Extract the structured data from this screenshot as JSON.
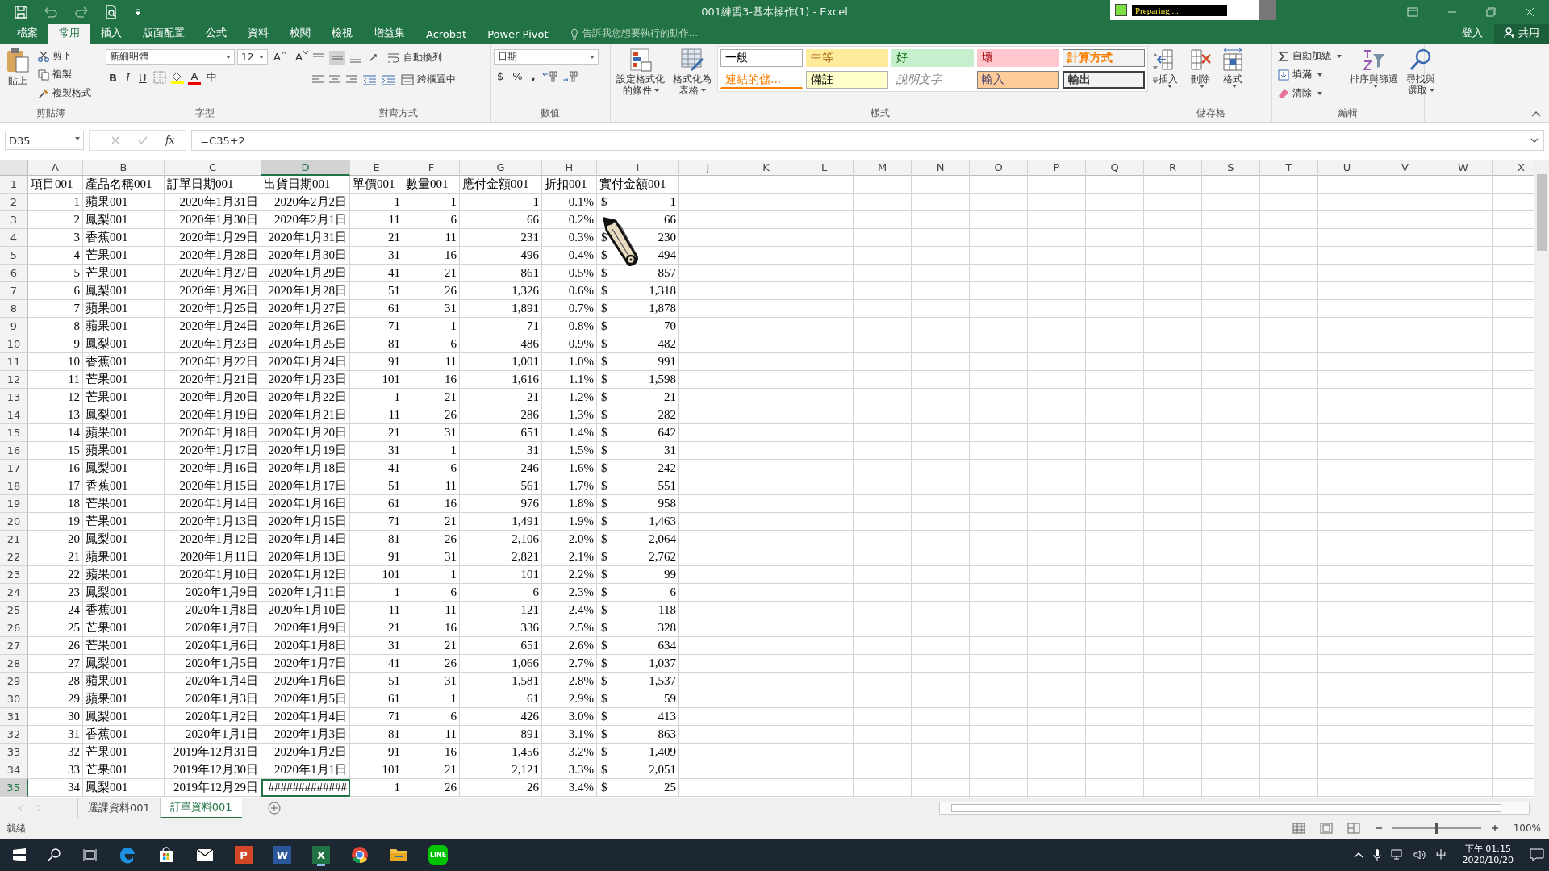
{
  "window": {
    "title": "001練習3-基本操作(1) - Excel",
    "progress": "Preparing ..."
  },
  "tabs": [
    {
      "label": "檔案",
      "selected": false
    },
    {
      "label": "常用",
      "selected": true
    },
    {
      "label": "插入",
      "selected": false
    },
    {
      "label": "版面配置",
      "selected": false
    },
    {
      "label": "公式",
      "selected": false
    },
    {
      "label": "資料",
      "selected": false
    },
    {
      "label": "校閱",
      "selected": false
    },
    {
      "label": "檢視",
      "selected": false
    },
    {
      "label": "增益集",
      "selected": false
    },
    {
      "label": "Acrobat",
      "selected": false
    },
    {
      "label": "Power Pivot",
      "selected": false
    }
  ],
  "tell_me": "告訴我您想要執行的動作...",
  "sign_in": "登入",
  "share": "共用",
  "ribbon": {
    "clipboard": {
      "label": "剪貼簿",
      "paste": "貼上",
      "cut": "剪下",
      "copy": "複製",
      "format_painter": "複製格式"
    },
    "font": {
      "label": "字型",
      "font_name": "新細明體",
      "font_size": "12",
      "grow": "A",
      "shrink": "A",
      "bold": "B",
      "italic": "I",
      "underline": "U",
      "font_color": "A",
      "phonetic": "中"
    },
    "alignment": {
      "label": "對齊方式",
      "wrap_text": "自動換列",
      "merge_center": "跨欄置中"
    },
    "number": {
      "label": "數值",
      "format": "日期",
      "currency": "$",
      "percent": "%",
      "comma": ","
    },
    "styles": {
      "label": "樣式",
      "conditional": [
        "設定格式化",
        "的條件"
      ],
      "as_table": [
        "格式化為",
        "表格"
      ],
      "gallery": [
        {
          "label": "一般",
          "kind": "normal"
        },
        {
          "label": "中等",
          "kind": "neutral"
        },
        {
          "label": "好",
          "kind": "good"
        },
        {
          "label": "壞",
          "kind": "bad"
        },
        {
          "label": "計算方式",
          "kind": "calculation"
        },
        {
          "label": "連結的儲...",
          "kind": "linked"
        },
        {
          "label": "備註",
          "kind": "note"
        },
        {
          "label": "說明文字",
          "kind": "explanatory"
        },
        {
          "label": "輸入",
          "kind": "input"
        },
        {
          "label": "輸出",
          "kind": "output"
        }
      ]
    },
    "cells": {
      "label": "儲存格",
      "insert": "插入",
      "delete": "刪除",
      "format": "格式"
    },
    "editing": {
      "label": "編輯",
      "autosum": "自動加總",
      "fill": "填滿",
      "clear": "清除",
      "sort": [
        "排序與篩選"
      ],
      "find": [
        "尋找與",
        "選取"
      ]
    }
  },
  "formula_bar": {
    "name_box": "D35",
    "fx": "fx",
    "formula": "=C35+2"
  },
  "columns": [
    {
      "label": "A",
      "selected": false
    },
    {
      "label": "B",
      "selected": false
    },
    {
      "label": "C",
      "selected": false
    },
    {
      "label": "D",
      "selected": true
    },
    {
      "label": "E",
      "selected": false
    },
    {
      "label": "F",
      "selected": false
    },
    {
      "label": "G",
      "selected": false
    },
    {
      "label": "H",
      "selected": false
    },
    {
      "label": "I",
      "selected": false
    },
    {
      "label": "J",
      "selected": false
    },
    {
      "label": "K",
      "selected": false
    },
    {
      "label": "L",
      "selected": false
    },
    {
      "label": "M",
      "selected": false
    },
    {
      "label": "N",
      "selected": false
    },
    {
      "label": "O",
      "selected": false
    },
    {
      "label": "P",
      "selected": false
    },
    {
      "label": "Q",
      "selected": false
    },
    {
      "label": "R",
      "selected": false
    },
    {
      "label": "S",
      "selected": false
    },
    {
      "label": "T",
      "selected": false
    },
    {
      "label": "U",
      "selected": false
    },
    {
      "label": "V",
      "selected": false
    },
    {
      "label": "W",
      "selected": false
    },
    {
      "label": "X",
      "selected": false
    }
  ],
  "rows": [
    {
      "n": "1",
      "kind": "header",
      "selected": false,
      "cells": [
        "項目001",
        "產品名稱001",
        "訂單日期001",
        "出貨日期001",
        "單價001",
        "數量001",
        "應付金額001",
        "折扣001",
        "實付金額001"
      ]
    },
    {
      "n": "2",
      "kind": "data",
      "selected": false,
      "currency": "$",
      "cells": [
        "1",
        "蘋果001",
        "2020年1月31日",
        "2020年2月2日",
        "1",
        "1",
        "1",
        "0.1%",
        "1"
      ]
    },
    {
      "n": "3",
      "kind": "data",
      "selected": false,
      "cells": [
        "2",
        "鳳梨001",
        "2020年1月30日",
        "2020年2月1日",
        "11",
        "6",
        "66",
        "0.2%",
        "66"
      ]
    },
    {
      "n": "4",
      "kind": "data",
      "selected": false,
      "currency": "$",
      "cells": [
        "3",
        "香蕉001",
        "2020年1月29日",
        "2020年1月31日",
        "21",
        "11",
        "231",
        "0.3%",
        "230"
      ]
    },
    {
      "n": "5",
      "kind": "data",
      "selected": false,
      "currency": "$",
      "cells": [
        "4",
        "芒果001",
        "2020年1月28日",
        "2020年1月30日",
        "31",
        "16",
        "496",
        "0.4%",
        "494"
      ]
    },
    {
      "n": "6",
      "kind": "data",
      "selected": false,
      "currency": "$",
      "cells": [
        "5",
        "芒果001",
        "2020年1月27日",
        "2020年1月29日",
        "41",
        "21",
        "861",
        "0.5%",
        "857"
      ]
    },
    {
      "n": "7",
      "kind": "data",
      "selected": false,
      "currency": "$",
      "cells": [
        "6",
        "鳳梨001",
        "2020年1月26日",
        "2020年1月28日",
        "51",
        "26",
        "1,326",
        "0.6%",
        "1,318"
      ]
    },
    {
      "n": "8",
      "kind": "data",
      "selected": false,
      "currency": "$",
      "cells": [
        "7",
        "蘋果001",
        "2020年1月25日",
        "2020年1月27日",
        "61",
        "31",
        "1,891",
        "0.7%",
        "1,878"
      ]
    },
    {
      "n": "9",
      "kind": "data",
      "selected": false,
      "currency": "$",
      "cells": [
        "8",
        "蘋果001",
        "2020年1月24日",
        "2020年1月26日",
        "71",
        "1",
        "71",
        "0.8%",
        "70"
      ]
    },
    {
      "n": "10",
      "kind": "data",
      "selected": false,
      "currency": "$",
      "cells": [
        "9",
        "鳳梨001",
        "2020年1月23日",
        "2020年1月25日",
        "81",
        "6",
        "486",
        "0.9%",
        "482"
      ]
    },
    {
      "n": "11",
      "kind": "data",
      "selected": false,
      "currency": "$",
      "cells": [
        "10",
        "香蕉001",
        "2020年1月22日",
        "2020年1月24日",
        "91",
        "11",
        "1,001",
        "1.0%",
        "991"
      ]
    },
    {
      "n": "12",
      "kind": "data",
      "selected": false,
      "currency": "$",
      "cells": [
        "11",
        "芒果001",
        "2020年1月21日",
        "2020年1月23日",
        "101",
        "16",
        "1,616",
        "1.1%",
        "1,598"
      ]
    },
    {
      "n": "13",
      "kind": "data",
      "selected": false,
      "currency": "$",
      "cells": [
        "12",
        "芒果001",
        "2020年1月20日",
        "2020年1月22日",
        "1",
        "21",
        "21",
        "1.2%",
        "21"
      ]
    },
    {
      "n": "14",
      "kind": "data",
      "selected": false,
      "currency": "$",
      "cells": [
        "13",
        "鳳梨001",
        "2020年1月19日",
        "2020年1月21日",
        "11",
        "26",
        "286",
        "1.3%",
        "282"
      ]
    },
    {
      "n": "15",
      "kind": "data",
      "selected": false,
      "currency": "$",
      "cells": [
        "14",
        "蘋果001",
        "2020年1月18日",
        "2020年1月20日",
        "21",
        "31",
        "651",
        "1.4%",
        "642"
      ]
    },
    {
      "n": "16",
      "kind": "data",
      "selected": false,
      "currency": "$",
      "cells": [
        "15",
        "蘋果001",
        "2020年1月17日",
        "2020年1月19日",
        "31",
        "1",
        "31",
        "1.5%",
        "31"
      ]
    },
    {
      "n": "17",
      "kind": "data",
      "selected": false,
      "currency": "$",
      "cells": [
        "16",
        "鳳梨001",
        "2020年1月16日",
        "2020年1月18日",
        "41",
        "6",
        "246",
        "1.6%",
        "242"
      ]
    },
    {
      "n": "18",
      "kind": "data",
      "selected": false,
      "currency": "$",
      "cells": [
        "17",
        "香蕉001",
        "2020年1月15日",
        "2020年1月17日",
        "51",
        "11",
        "561",
        "1.7%",
        "551"
      ]
    },
    {
      "n": "19",
      "kind": "data",
      "selected": false,
      "currency": "$",
      "cells": [
        "18",
        "芒果001",
        "2020年1月14日",
        "2020年1月16日",
        "61",
        "16",
        "976",
        "1.8%",
        "958"
      ]
    },
    {
      "n": "20",
      "kind": "data",
      "selected": false,
      "currency": "$",
      "cells": [
        "19",
        "芒果001",
        "2020年1月13日",
        "2020年1月15日",
        "71",
        "21",
        "1,491",
        "1.9%",
        "1,463"
      ]
    },
    {
      "n": "21",
      "kind": "data",
      "selected": false,
      "currency": "$",
      "cells": [
        "20",
        "鳳梨001",
        "2020年1月12日",
        "2020年1月14日",
        "81",
        "26",
        "2,106",
        "2.0%",
        "2,064"
      ]
    },
    {
      "n": "22",
      "kind": "data",
      "selected": false,
      "currency": "$",
      "cells": [
        "21",
        "蘋果001",
        "2020年1月11日",
        "2020年1月13日",
        "91",
        "31",
        "2,821",
        "2.1%",
        "2,762"
      ]
    },
    {
      "n": "23",
      "kind": "data",
      "selected": false,
      "currency": "$",
      "cells": [
        "22",
        "蘋果001",
        "2020年1月10日",
        "2020年1月12日",
        "101",
        "1",
        "101",
        "2.2%",
        "99"
      ]
    },
    {
      "n": "24",
      "kind": "data",
      "selected": false,
      "currency": "$",
      "cells": [
        "23",
        "鳳梨001",
        "2020年1月9日",
        "2020年1月11日",
        "1",
        "6",
        "6",
        "2.3%",
        "6"
      ]
    },
    {
      "n": "25",
      "kind": "data",
      "selected": false,
      "currency": "$",
      "cells": [
        "24",
        "香蕉001",
        "2020年1月8日",
        "2020年1月10日",
        "11",
        "11",
        "121",
        "2.4%",
        "118"
      ]
    },
    {
      "n": "26",
      "kind": "data",
      "selected": false,
      "currency": "$",
      "cells": [
        "25",
        "芒果001",
        "2020年1月7日",
        "2020年1月9日",
        "21",
        "16",
        "336",
        "2.5%",
        "328"
      ]
    },
    {
      "n": "27",
      "kind": "data",
      "selected": false,
      "currency": "$",
      "cells": [
        "26",
        "芒果001",
        "2020年1月6日",
        "2020年1月8日",
        "31",
        "21",
        "651",
        "2.6%",
        "634"
      ]
    },
    {
      "n": "28",
      "kind": "data",
      "selected": false,
      "currency": "$",
      "cells": [
        "27",
        "鳳梨001",
        "2020年1月5日",
        "2020年1月7日",
        "41",
        "26",
        "1,066",
        "2.7%",
        "1,037"
      ]
    },
    {
      "n": "29",
      "kind": "data",
      "selected": false,
      "currency": "$",
      "cells": [
        "28",
        "蘋果001",
        "2020年1月4日",
        "2020年1月6日",
        "51",
        "31",
        "1,581",
        "2.8%",
        "1,537"
      ]
    },
    {
      "n": "30",
      "kind": "data",
      "selected": false,
      "currency": "$",
      "cells": [
        "29",
        "蘋果001",
        "2020年1月3日",
        "2020年1月5日",
        "61",
        "1",
        "61",
        "2.9%",
        "59"
      ]
    },
    {
      "n": "31",
      "kind": "data",
      "selected": false,
      "currency": "$",
      "cells": [
        "30",
        "鳳梨001",
        "2020年1月2日",
        "2020年1月4日",
        "71",
        "6",
        "426",
        "3.0%",
        "413"
      ]
    },
    {
      "n": "32",
      "kind": "data",
      "selected": false,
      "currency": "$",
      "cells": [
        "31",
        "香蕉001",
        "2020年1月1日",
        "2020年1月3日",
        "81",
        "11",
        "891",
        "3.1%",
        "863"
      ]
    },
    {
      "n": "33",
      "kind": "data",
      "selected": false,
      "currency": "$",
      "cells": [
        "32",
        "芒果001",
        "2019年12月31日",
        "2020年1月2日",
        "91",
        "16",
        "1,456",
        "3.2%",
        "1,409"
      ]
    },
    {
      "n": "34",
      "kind": "data",
      "selected": false,
      "currency": "$",
      "cells": [
        "33",
        "芒果001",
        "2019年12月30日",
        "2020年1月1日",
        "101",
        "21",
        "2,121",
        "3.3%",
        "2,051"
      ]
    },
    {
      "n": "35",
      "kind": "data",
      "selected": true,
      "currency": "$",
      "cells": [
        "34",
        "鳳梨001",
        "2019年12月29日",
        "#############",
        "1",
        "26",
        "26",
        "3.4%",
        "25"
      ]
    }
  ],
  "sheets": [
    {
      "label": "選課資料001",
      "selected": false
    },
    {
      "label": "訂單資料001",
      "selected": true
    }
  ],
  "status_bar": {
    "status": "就緒",
    "zoom": "100%",
    "zoom_slider": {
      "level": 0.5
    }
  },
  "taskbar": {
    "apps": [
      {
        "kind": "search"
      },
      {
        "kind": "taskview"
      },
      {
        "kind": "edge"
      },
      {
        "kind": "store"
      },
      {
        "kind": "mail"
      },
      {
        "kind": "app",
        "label": "P",
        "color": "#d24726"
      },
      {
        "kind": "app",
        "label": "W",
        "color": "#2b579a"
      },
      {
        "kind": "app",
        "label": "X",
        "color": "#217346",
        "selected": true
      },
      {
        "kind": "chrome"
      },
      {
        "kind": "folder"
      },
      {
        "kind": "line",
        "label": "LINE"
      }
    ],
    "ime": "中",
    "time": "下午 01:15",
    "date": "2020/10/20"
  }
}
